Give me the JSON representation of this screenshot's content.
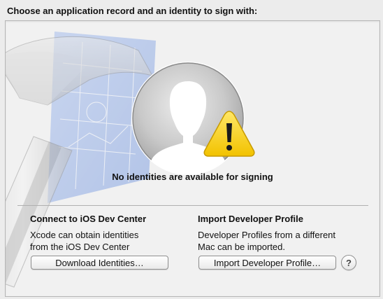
{
  "heading": "Choose an application record and an identity to sign with:",
  "status": {
    "message": "No identities are available for signing"
  },
  "connect": {
    "title": "Connect to iOS Dev Center",
    "desc_line1": "Xcode can obtain identities",
    "desc_line2": "from the iOS Dev Center",
    "button_label": "Download Identities…"
  },
  "import": {
    "title": "Import Developer Profile",
    "desc_line1": "Developer Profiles from a different",
    "desc_line2": "Mac can be imported.",
    "button_label": "Import Developer Profile…"
  },
  "help": {
    "label": "?"
  },
  "icons": {
    "avatar": "person-silhouette-icon",
    "warning": "warning-triangle-icon",
    "background": "xcode-hammer-blueprint-icon"
  },
  "colors": {
    "warning_fill": "#f5c800",
    "blueprint": "#3f6fd6"
  }
}
